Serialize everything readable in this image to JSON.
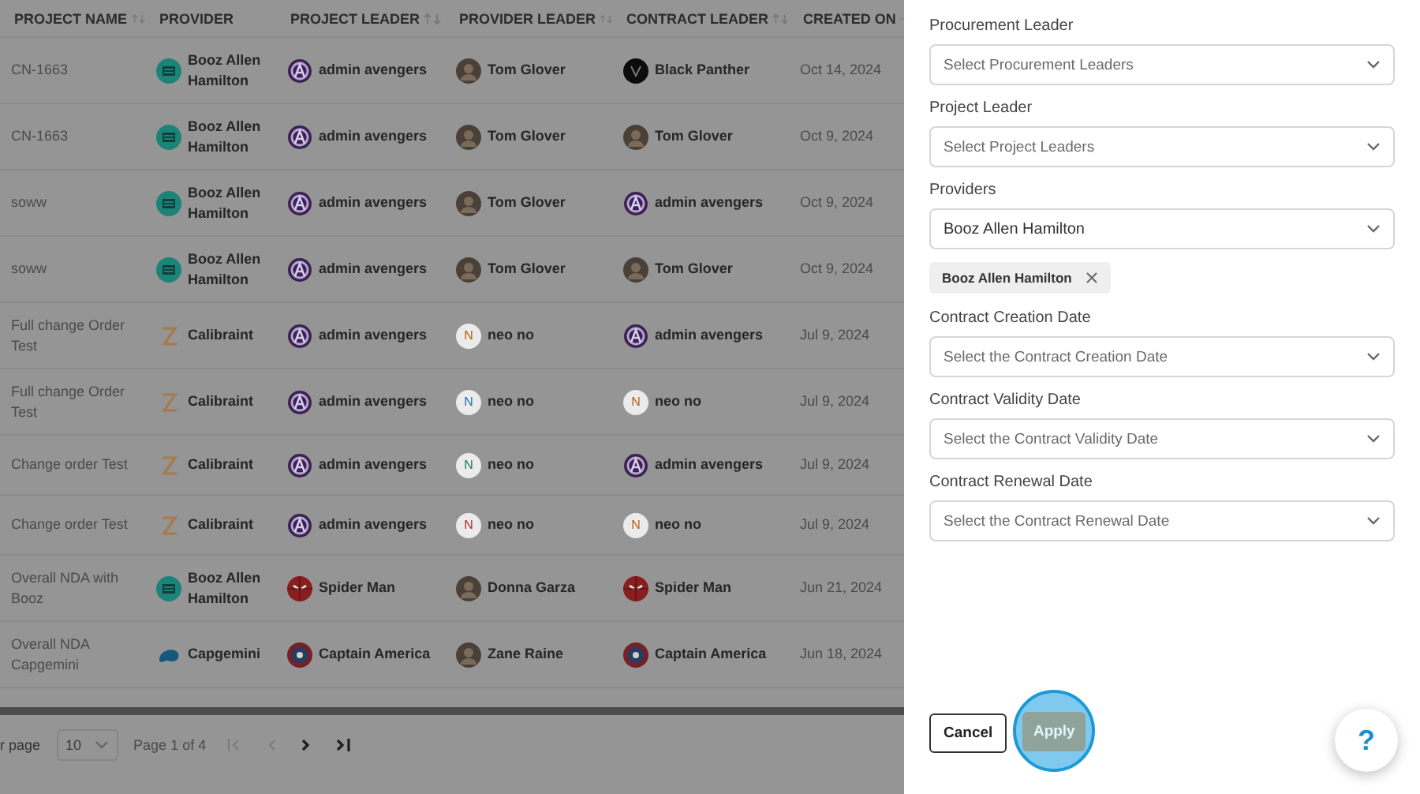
{
  "table": {
    "columns": [
      {
        "label": "PROJECT NAME",
        "kind": "sortable"
      },
      {
        "label": "PROVIDER",
        "kind": "plain"
      },
      {
        "label": "PROJECT LEADER",
        "kind": "sortable"
      },
      {
        "label": "PROVIDER LEADER",
        "kind": "sortable"
      },
      {
        "label": "CONTRACT LEADER",
        "kind": "sortable"
      },
      {
        "label": "CREATED ON",
        "kind": "sorted"
      }
    ],
    "rows": [
      {
        "project": "CN-1663",
        "provider": {
          "name": "Booz Allen Hamilton",
          "kind": "booz"
        },
        "project_leader": {
          "name": "admin avengers",
          "kind": "avengers"
        },
        "provider_leader": {
          "name": "Tom Glover",
          "kind": "photo"
        },
        "contract_leader": {
          "name": "Black Panther",
          "kind": "panther"
        },
        "created": "Oct 14, 2024"
      },
      {
        "project": "CN-1663",
        "provider": {
          "name": "Booz Allen Hamilton",
          "kind": "booz"
        },
        "project_leader": {
          "name": "admin avengers",
          "kind": "avengers"
        },
        "provider_leader": {
          "name": "Tom Glover",
          "kind": "photo"
        },
        "contract_leader": {
          "name": "Tom Glover",
          "kind": "photo"
        },
        "created": "Oct 9, 2024"
      },
      {
        "project": "soww",
        "provider": {
          "name": "Booz Allen Hamilton",
          "kind": "booz"
        },
        "project_leader": {
          "name": "admin avengers",
          "kind": "avengers"
        },
        "provider_leader": {
          "name": "Tom Glover",
          "kind": "photo"
        },
        "contract_leader": {
          "name": "admin avengers",
          "kind": "avengers"
        },
        "created": "Oct 9, 2024"
      },
      {
        "project": "soww",
        "provider": {
          "name": "Booz Allen Hamilton",
          "kind": "booz"
        },
        "project_leader": {
          "name": "admin avengers",
          "kind": "avengers"
        },
        "provider_leader": {
          "name": "Tom Glover",
          "kind": "photo"
        },
        "contract_leader": {
          "name": "Tom Glover",
          "kind": "photo"
        },
        "created": "Oct 9, 2024"
      },
      {
        "project": "Full change Order Test",
        "provider": {
          "name": "Calibraint",
          "kind": "calibraint"
        },
        "project_leader": {
          "name": "admin avengers",
          "kind": "avengers"
        },
        "provider_leader": {
          "name": "neo no",
          "kind": "initial",
          "letter": "N",
          "color": "#b85e10"
        },
        "contract_leader": {
          "name": "admin avengers",
          "kind": "avengers"
        },
        "created": "Jul 9, 2024"
      },
      {
        "project": "Full change Order Test",
        "provider": {
          "name": "Calibraint",
          "kind": "calibraint"
        },
        "project_leader": {
          "name": "admin avengers",
          "kind": "avengers"
        },
        "provider_leader": {
          "name": "neo no",
          "kind": "initial",
          "letter": "N",
          "color": "#1f6fb8"
        },
        "contract_leader": {
          "name": "neo no",
          "kind": "initial",
          "letter": "N",
          "color": "#b85e10"
        },
        "created": "Jul 9, 2024"
      },
      {
        "project": "Change order Test",
        "provider": {
          "name": "Calibraint",
          "kind": "calibraint"
        },
        "project_leader": {
          "name": "admin avengers",
          "kind": "avengers"
        },
        "provider_leader": {
          "name": "neo no",
          "kind": "initial",
          "letter": "N",
          "color": "#1f7a3f"
        },
        "contract_leader": {
          "name": "admin avengers",
          "kind": "avengers"
        },
        "created": "Jul 9, 2024"
      },
      {
        "project": "Change order Test",
        "provider": {
          "name": "Calibraint",
          "kind": "calibraint"
        },
        "project_leader": {
          "name": "admin avengers",
          "kind": "avengers"
        },
        "provider_leader": {
          "name": "neo no",
          "kind": "initial",
          "letter": "N",
          "color": "#b8283c"
        },
        "contract_leader": {
          "name": "neo no",
          "kind": "initial",
          "letter": "N",
          "color": "#b85e10"
        },
        "created": "Jul 9, 2024"
      },
      {
        "project": "Overall NDA with Booz",
        "provider": {
          "name": "Booz Allen Hamilton",
          "kind": "booz"
        },
        "project_leader": {
          "name": "Spider Man",
          "kind": "spider"
        },
        "provider_leader": {
          "name": "Donna Garza",
          "kind": "photo"
        },
        "contract_leader": {
          "name": "Spider Man",
          "kind": "spider"
        },
        "created": "Jun 21, 2024"
      },
      {
        "project": "Overall NDA Capgemini",
        "provider": {
          "name": "Capgemini",
          "kind": "capgemini"
        },
        "project_leader": {
          "name": "Captain America",
          "kind": "captain"
        },
        "provider_leader": {
          "name": "Zane Raine",
          "kind": "photo"
        },
        "contract_leader": {
          "name": "Captain America",
          "kind": "captain"
        },
        "created": "Jun 18, 2024"
      }
    ]
  },
  "pagination": {
    "rows_label": "r page",
    "page_size": "10",
    "page_info": "Page 1 of 4",
    "first_disabled": true,
    "prev_disabled": true,
    "next_disabled": false,
    "last_disabled": false
  },
  "filters": [
    {
      "label": "Procurement Leader",
      "placeholder": "Select Procurement Leaders"
    },
    {
      "label": "Project Leader",
      "placeholder": "Select Project Leaders"
    },
    {
      "label": "Providers",
      "value": "Booz Allen Hamilton",
      "chips": [
        "Booz Allen Hamilton"
      ]
    },
    {
      "label": "Contract Creation Date",
      "placeholder": "Select the Contract Creation Date"
    },
    {
      "label": "Contract Validity Date",
      "placeholder": "Select the Contract Validity Date"
    },
    {
      "label": "Contract Renewal Date",
      "placeholder": "Select the Contract Renewal Date"
    }
  ],
  "actions": {
    "cancel": "Cancel",
    "apply": "Apply",
    "apply_disabled": true,
    "apply_highlighted": true
  },
  "help": "?"
}
